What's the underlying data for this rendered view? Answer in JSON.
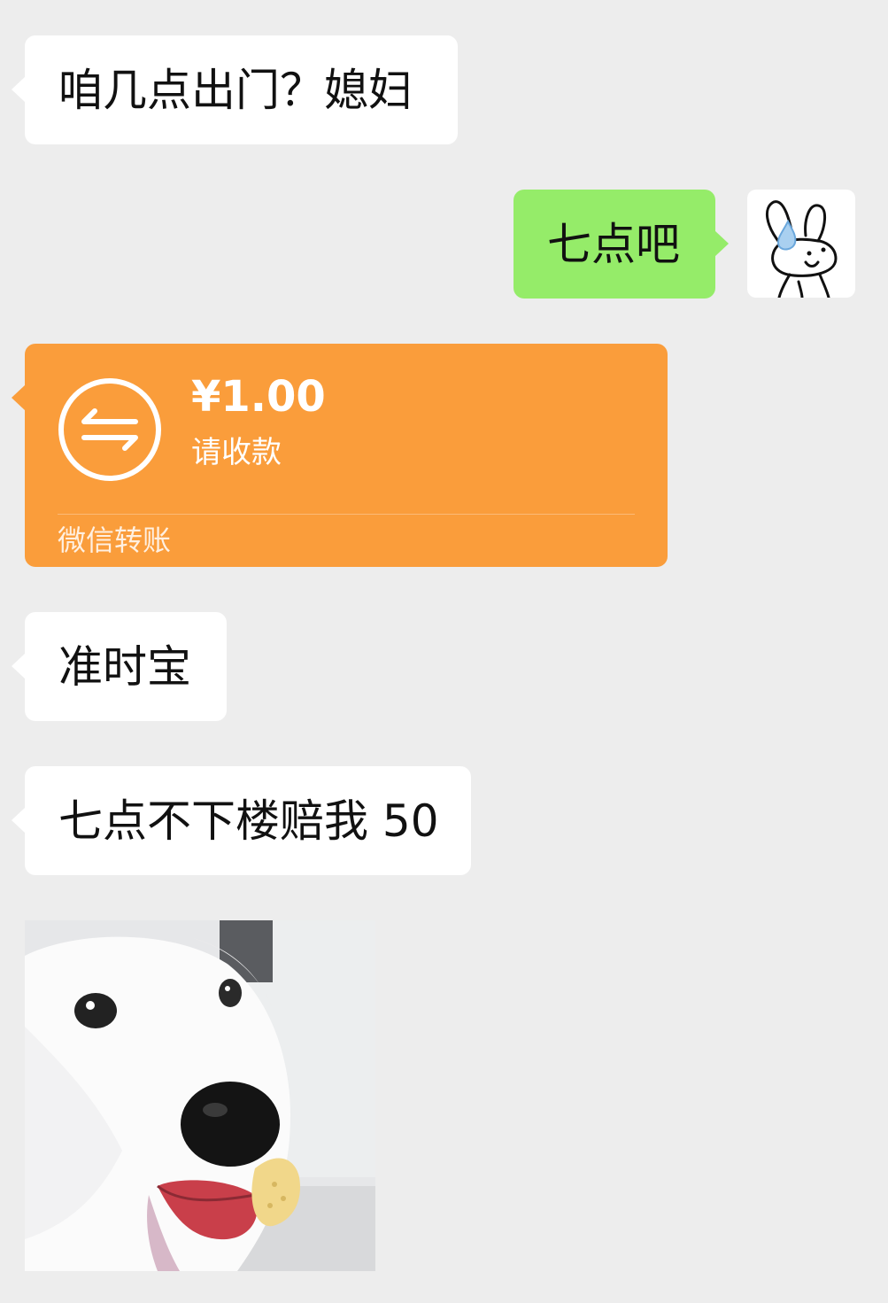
{
  "messages": [
    {
      "sender": "other",
      "text": "咱几点出门？媳妇"
    },
    {
      "sender": "me",
      "text": "七点吧"
    },
    {
      "sender": "other",
      "type": "transfer",
      "amount": "¥1.00",
      "subtitle": "请收款",
      "footer": "微信转账"
    },
    {
      "sender": "other",
      "text": "准时宝"
    },
    {
      "sender": "other",
      "text": "七点不下楼赔我 50"
    },
    {
      "sender": "other",
      "type": "image",
      "image_label": "white-dog-sticker"
    }
  ],
  "my_avatar": {
    "icon": "bunny-sweat-avatar-icon"
  },
  "colors": {
    "background": "#ededed",
    "incoming_bubble": "#ffffff",
    "outgoing_bubble": "#95ec69",
    "transfer_bubble": "#fa9d3b"
  }
}
